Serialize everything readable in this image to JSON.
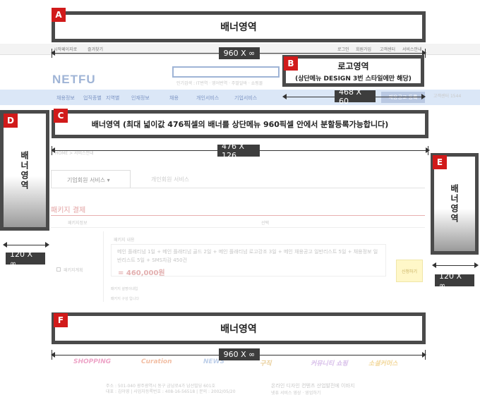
{
  "badges": {
    "a": "A",
    "b": "B",
    "c": "C",
    "d": "D",
    "e": "E",
    "f": "F"
  },
  "banners": {
    "a_label": "배너영역",
    "b_title": "로고영역",
    "b_sub": "(상단메뉴 DESIGN 3번 스타일에만 해당)",
    "c_label": "배너영역 (최대 넓이값 476픽셀의 배너를 상단메뉴 960픽셀 안에서 분할등록가능합니다)",
    "d_label": "배너영역",
    "e_label": "배너영역",
    "f_label": "배너영역"
  },
  "dimensions": {
    "a": "960 X ∞",
    "b": "468 X 60",
    "c": "476 X 126",
    "d": "120 X ∞",
    "e": "120 X ∞",
    "f": "960 X ∞"
  },
  "topbar": {
    "left_items": [
      "시작페이지로",
      "즐겨찾기"
    ],
    "right_items": [
      "로그인",
      "회원가입",
      "고객센터",
      "서비스안내"
    ]
  },
  "logo": "NETFU",
  "search_links": "인기검색 : IT번역 · 영어번역 · 주말알바 · 쇼핑몰",
  "nav": {
    "items": [
      "채용정보",
      "업직종별",
      "지역별",
      "인재정보",
      "채용",
      "개인서비스",
      "기업서비스"
    ],
    "right_button": "채용공고 등록",
    "side_text": "고객센터 1544"
  },
  "breadcrumb": "HOME > 서비스안내",
  "tabs": {
    "active": "기업회원 서비스 ▾",
    "inactive": "개인회원 서비스"
  },
  "section": {
    "title": "패키지 결제",
    "col1": "패키지정보",
    "col2": "선택",
    "content_head": "패키지 내용",
    "content_body": "메인 플래티넘 1일 + 메인 플래티넘 골드 2일 + 메인 플래티넘 로고강조 3일 + 메인 채용공고 일반리스트 5일 + 채용정보 일반리스트 5일 + SMS차감 450건",
    "price": "= 460,000원",
    "checkbox_label": "패키지계획",
    "note1": "패키지 설명이내입",
    "note2": "패키지 구성 입니다",
    "apply_button": "신청하기"
  },
  "footer_brands": [
    {
      "name": "SHOPPING",
      "color": "#e05a9a"
    },
    {
      "name": "Curation",
      "color": "#e88a5a"
    },
    {
      "name": "NEWS",
      "color": "#8aa8d8"
    },
    {
      "name": "구직",
      "color": "#d8a84a"
    },
    {
      "name": "커뮤니티 쇼핑",
      "color": "#b88ad8"
    },
    {
      "name": "소셜커머스",
      "color": "#e8b84a"
    }
  ],
  "footer_info": {
    "line1": "주소 : 501-040 광주광역시 동구 금남로4가 남선빌딩 601호",
    "line2": "대표 : 김아영 | 사업자등록번호 : 408-16-56518 | 문의 : 2002/05/20",
    "right1": "온라인 디자인 컨텐츠 산업발전에 이바지",
    "right2": "넷퓨 서비스 영상 · 영업하기"
  }
}
